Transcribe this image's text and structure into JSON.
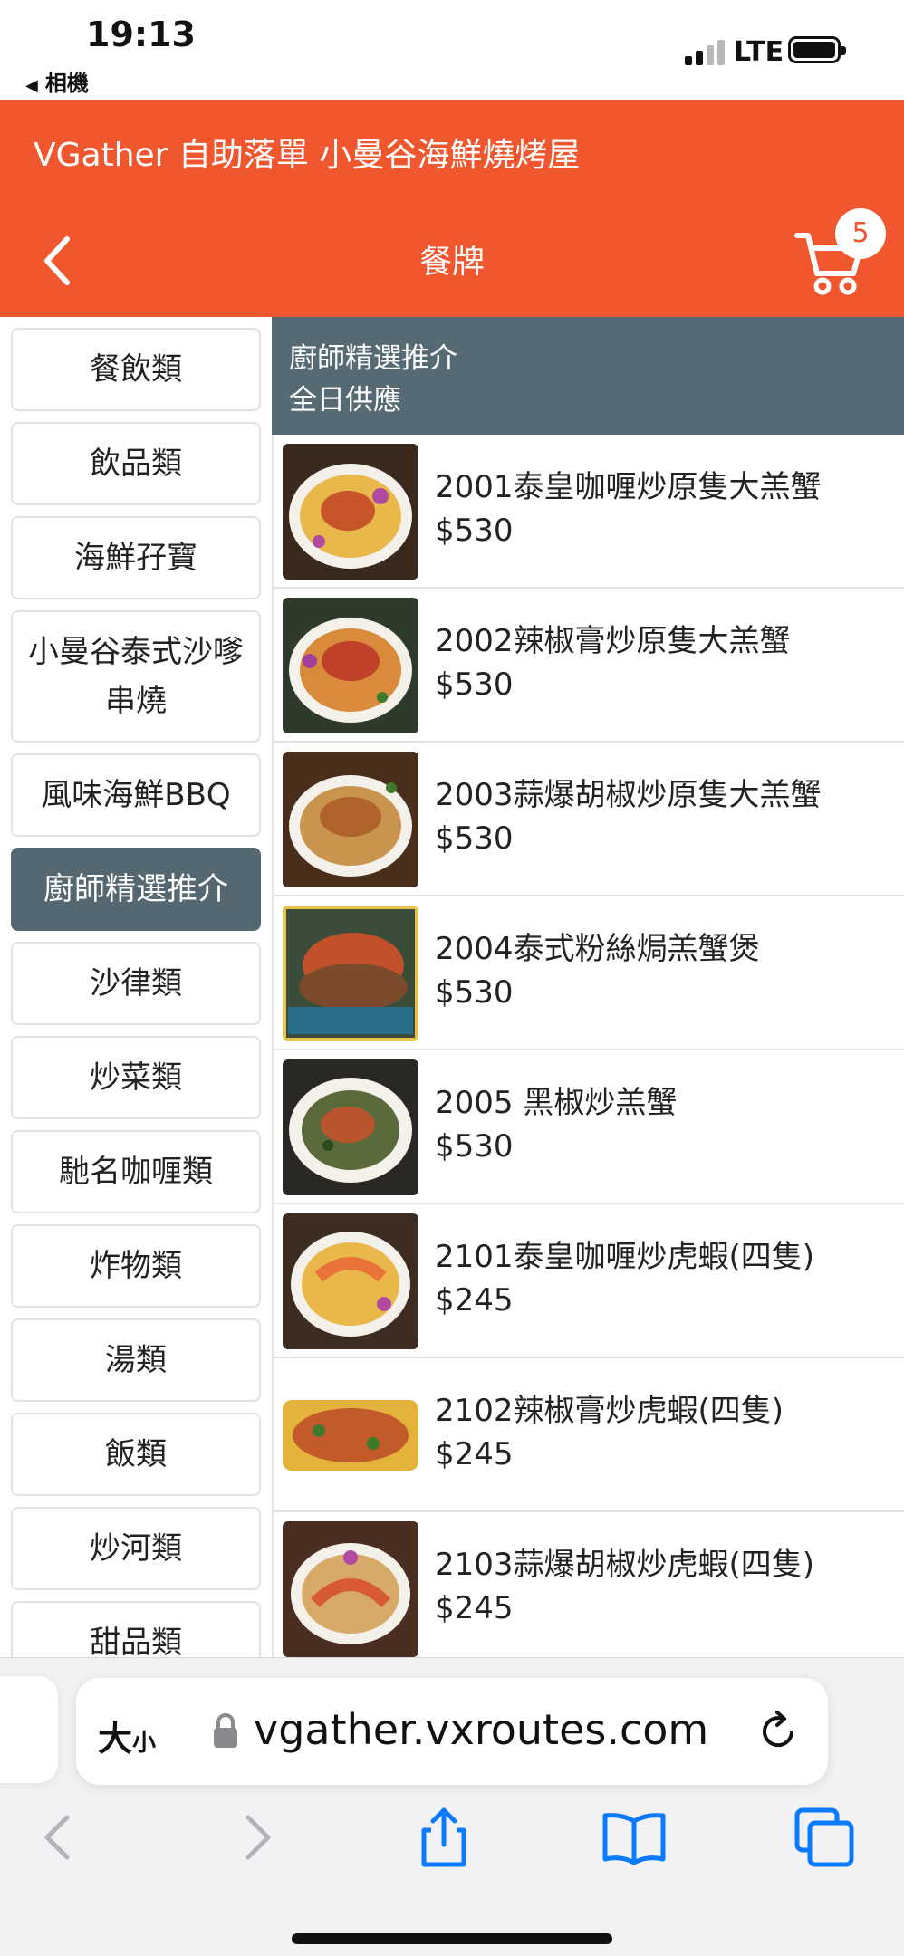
{
  "status_bar": {
    "time": "19:13",
    "back_app": "相機",
    "network": "LTE"
  },
  "header": {
    "restaurant_title": "VGather 自助落單 小曼谷海鮮燒烤屋",
    "nav_title": "餐牌",
    "cart_count": "5",
    "brand_color": "#f0572f"
  },
  "categories": [
    {
      "label": "餐飲類",
      "active": false
    },
    {
      "label": "飲品類",
      "active": false
    },
    {
      "label": "海鮮孖寶",
      "active": false
    },
    {
      "label": "小曼谷泰式沙嗲串燒",
      "active": false
    },
    {
      "label": "風味海鮮BBQ",
      "active": false
    },
    {
      "label": "廚師精選推介",
      "active": true
    },
    {
      "label": "沙律類",
      "active": false
    },
    {
      "label": "炒菜類",
      "active": false
    },
    {
      "label": "馳名咖喱類",
      "active": false
    },
    {
      "label": "炸物類",
      "active": false
    },
    {
      "label": "湯類",
      "active": false
    },
    {
      "label": "飯類",
      "active": false
    },
    {
      "label": "炒河類",
      "active": false
    },
    {
      "label": "甜品類",
      "active": false
    }
  ],
  "section": {
    "title": "廚師精選推介",
    "subtitle": "全日供應",
    "color": "#566a74"
  },
  "items": [
    {
      "name": "2001泰皇咖喱炒原隻大羔蟹",
      "price": "$530",
      "icon": "crab-curry-photo"
    },
    {
      "name": "2002辣椒膏炒原隻大羔蟹",
      "price": "$530",
      "icon": "crab-chili-photo"
    },
    {
      "name": "2003蒜爆胡椒炒原隻大羔蟹",
      "price": "$530",
      "icon": "crab-garlic-photo"
    },
    {
      "name": "2004泰式粉絲焗羔蟹煲",
      "price": "$530",
      "icon": "crab-vermicelli-photo"
    },
    {
      "name": "2005 黑椒炒羔蟹",
      "price": "$530",
      "icon": "crab-blackpepper-photo"
    },
    {
      "name": "2101泰皇咖喱炒虎蝦(四隻)",
      "price": "$245",
      "icon": "prawn-curry-photo"
    },
    {
      "name": "2102辣椒膏炒虎蝦(四隻)",
      "price": "$245",
      "icon": "prawn-chili-photo"
    },
    {
      "name": "2103蒜爆胡椒炒虎蝦(四隻)",
      "price": "$245",
      "icon": "prawn-garlic-photo"
    }
  ],
  "browser": {
    "text_size_big": "大",
    "text_size_small": "小",
    "url": "vgather.vxroutes.com",
    "accent": "#0a7aff"
  }
}
